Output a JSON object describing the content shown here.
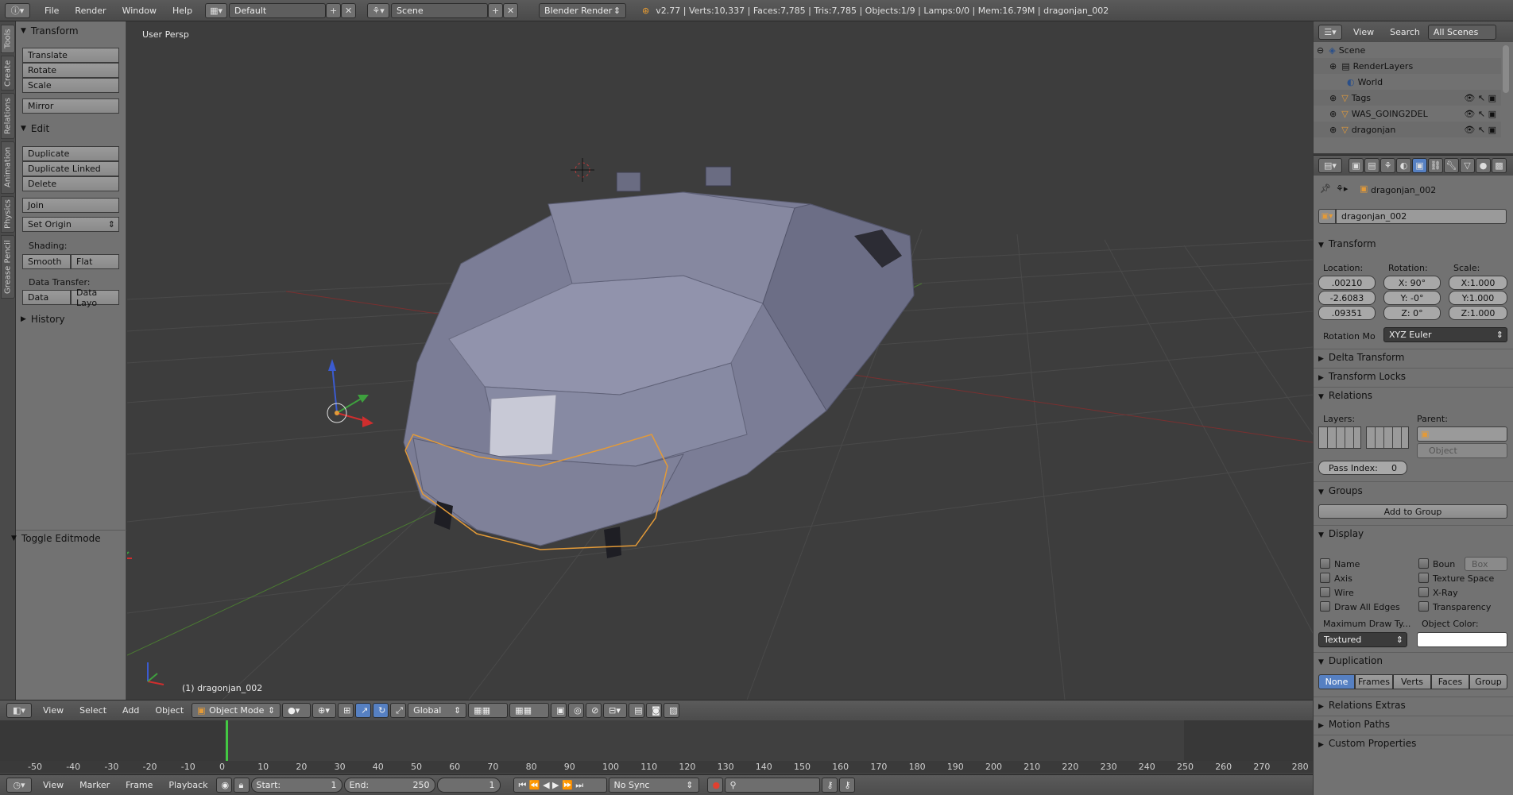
{
  "topbar": {
    "menus": [
      "File",
      "Render",
      "Window",
      "Help"
    ],
    "layout": "Default",
    "scene": "Scene",
    "engine": "Blender Render",
    "stats": "v2.77 | Verts:10,337 | Faces:7,785 | Tris:7,785 | Objects:1/9 | Lamps:0/0 | Mem:16.79M | dragonjan_002"
  },
  "tabs": [
    "Tools",
    "Create",
    "Relations",
    "Animation",
    "Physics",
    "Grease Pencil"
  ],
  "toolshelf": {
    "transform_header": "Transform",
    "translate": "Translate",
    "rotate": "Rotate",
    "scale": "Scale",
    "mirror": "Mirror",
    "edit_header": "Edit",
    "duplicate": "Duplicate",
    "duplicate_linked": "Duplicate Linked",
    "delete": "Delete",
    "join": "Join",
    "set_origin": "Set Origin",
    "shading_label": "Shading:",
    "smooth": "Smooth",
    "flat": "Flat",
    "data_transfer_label": "Data Transfer:",
    "data": "Data",
    "data_layout": "Data Layo",
    "history_header": "History",
    "toggle_editmode": "Toggle Editmode"
  },
  "viewport": {
    "view_label": "User Persp",
    "object_label": "(1) dragonjan_002"
  },
  "viewport_header": {
    "view": "View",
    "select": "Select",
    "add": "Add",
    "object": "Object",
    "mode": "Object Mode",
    "orientation": "Global"
  },
  "timeline": {
    "ticks": [
      "-50",
      "-40",
      "-30",
      "-20",
      "-10",
      "0",
      "10",
      "20",
      "30",
      "40",
      "50",
      "60",
      "70",
      "80",
      "90",
      "100",
      "110",
      "120",
      "130",
      "140",
      "150",
      "160",
      "170",
      "180",
      "190",
      "200",
      "210",
      "220",
      "230",
      "240",
      "250",
      "260",
      "270",
      "280"
    ],
    "view": "View",
    "marker": "Marker",
    "frame": "Frame",
    "playback": "Playback",
    "start_label": "Start:",
    "start_value": "1",
    "end_label": "End:",
    "end_value": "250",
    "current_frame": "1",
    "sync": "No Sync"
  },
  "outliner": {
    "view": "View",
    "search": "Search",
    "filter": "All Scenes",
    "items": [
      "Scene",
      "RenderLayers",
      "World",
      "Tags",
      "WAS_GOING2DEL",
      "dragonjan"
    ]
  },
  "properties": {
    "breadcrumb": "dragonjan_002",
    "object_name": "dragonjan_002",
    "transform_header": "Transform",
    "location_label": "Location:",
    "rotation_label": "Rotation:",
    "scale_label": "Scale:",
    "location": [
      ".00210",
      "-2.6083",
      ".09351"
    ],
    "rotation": [
      "X:  90°",
      "Y:   -0°",
      "Z:    0°"
    ],
    "scale": [
      "X:1.000",
      "Y:1.000",
      "Z:1.000"
    ],
    "rotation_mode_label": "Rotation Mo",
    "rotation_mode": "XYZ Euler",
    "delta_transform": "Delta Transform",
    "transform_locks": "Transform Locks",
    "relations_header": "Relations",
    "layers_label": "Layers:",
    "parent_label": "Parent:",
    "parent_type": "Object",
    "pass_index_label": "Pass Index:",
    "pass_index": "0",
    "groups_header": "Groups",
    "add_to_group": "Add to Group",
    "display_header": "Display",
    "name": "Name",
    "axis": "Axis",
    "wire": "Wire",
    "draw_all_edges": "Draw All Edges",
    "bounds": "Boun",
    "bounds_type": "Box",
    "texture_space": "Texture Space",
    "xray": "X-Ray",
    "transparency": "Transparency",
    "max_draw_type_label": "Maximum Draw Ty...",
    "max_draw_type": "Textured",
    "object_color_label": "Object Color:",
    "duplication_header": "Duplication",
    "dup_options": [
      "None",
      "Frames",
      "Verts",
      "Faces",
      "Group"
    ],
    "relations_extras": "Relations Extras",
    "motion_paths": "Motion Paths",
    "custom_properties": "Custom Properties"
  },
  "colors": {
    "selection_outline": "#e39a38",
    "accent": "#5680c2",
    "x_axis": "#c23c3c",
    "y_axis": "#5fa33a"
  }
}
